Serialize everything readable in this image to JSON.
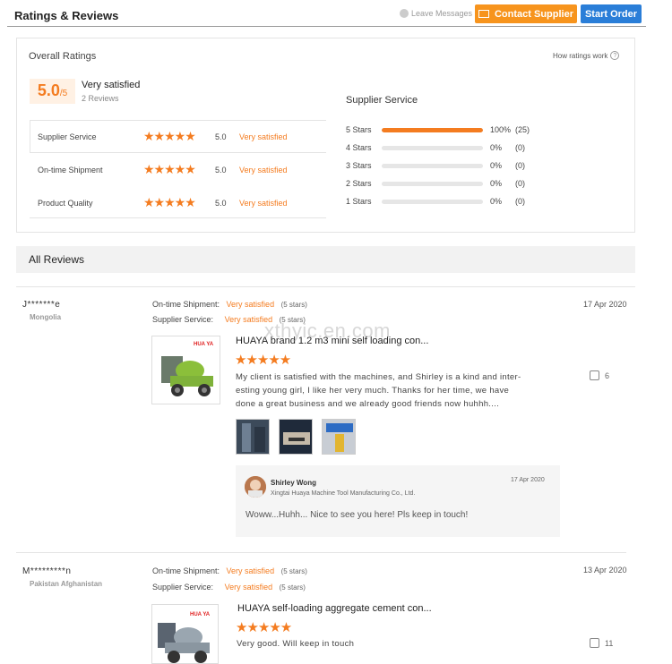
{
  "header": {
    "title": "Ratings & Reviews",
    "leave_messages": "Leave Messages",
    "contact_supplier": "Contact Supplier",
    "start_order": "Start Order"
  },
  "overall": {
    "label": "Overall Ratings",
    "how_ratings_work": "How ratings work",
    "score": "5.0",
    "score_suffix": "/5",
    "satisfaction": "Very satisfied",
    "reviews_count": "2 Reviews",
    "categories": [
      {
        "label": "Supplier Service",
        "stars": "★★★★★",
        "score": "5.0",
        "satisfaction": "Very satisfied"
      },
      {
        "label": "On-time Shipment",
        "stars": "★★★★★",
        "score": "5.0",
        "satisfaction": "Very satisfied"
      },
      {
        "label": "Product Quality",
        "stars": "★★★★★",
        "score": "5.0",
        "satisfaction": "Very satisfied"
      }
    ]
  },
  "supplier_service": {
    "title": "Supplier Service",
    "bars": [
      {
        "label": "5 Stars",
        "percent_text": "100%",
        "count": "(25)",
        "fraction": 1.0
      },
      {
        "label": "4 Stars",
        "percent_text": "0%",
        "count": "(0)",
        "fraction": 0
      },
      {
        "label": "3 Stars",
        "percent_text": "0%",
        "count": "(0)",
        "fraction": 0
      },
      {
        "label": "2 Stars",
        "percent_text": "0%",
        "count": "(0)",
        "fraction": 0
      },
      {
        "label": "1 Stars",
        "percent_text": "0%",
        "count": "(0)",
        "fraction": 0
      }
    ]
  },
  "all_reviews": {
    "title": "All Reviews",
    "watermark": "xthyic.en.com",
    "items": [
      {
        "name": "J*******e",
        "country": "Mongolia",
        "shipment_label": "On-time Shipment:",
        "shipment_value": "Very satisfied",
        "shipment_stars": "(5 stars)",
        "service_label": "Supplier Service:",
        "service_value": "Very satisfied",
        "service_stars": "(5 stars)",
        "date": "17 Apr 2020",
        "product_brand": "HUA YA",
        "product_title": "HUAYA brand 1.2 m3 mini self loading con...",
        "stars": "★★★★★",
        "text_lines": [
          "My client is satisfied with the machines, and Shirley is a kind and inter-",
          "esting young girl, I like her very much. Thanks for her time, we have",
          "done a great business and we already good friends now huhhh...."
        ],
        "likes": "6",
        "reply": {
          "name": "Shirley Wong",
          "company": "Xingtai Huaya Machine Tool Manufacturing Co., Ltd.",
          "date": "17 Apr 2020",
          "text": "Woww...Huhh... Nice to see you here! Pls keep in touch!"
        }
      },
      {
        "name": "M*********n",
        "country": "Pakistan Afghanistan",
        "shipment_label": "On-time Shipment:",
        "shipment_value": "Very satisfied",
        "shipment_stars": "(5 stars)",
        "service_label": "Supplier Service:",
        "service_value": "Very satisfied",
        "service_stars": "(5 stars)",
        "date": "13 Apr 2020",
        "product_brand": "HUA YA",
        "product_title": "HUAYA self-loading aggregate cement con...",
        "stars": "★★★★★",
        "text_lines": [
          "Very good. Will keep in touch"
        ],
        "likes": "11"
      }
    ]
  },
  "colors": {
    "accent": "#f47c20",
    "contact_button": "#f7941d",
    "start_button": "#2a7ed8"
  }
}
